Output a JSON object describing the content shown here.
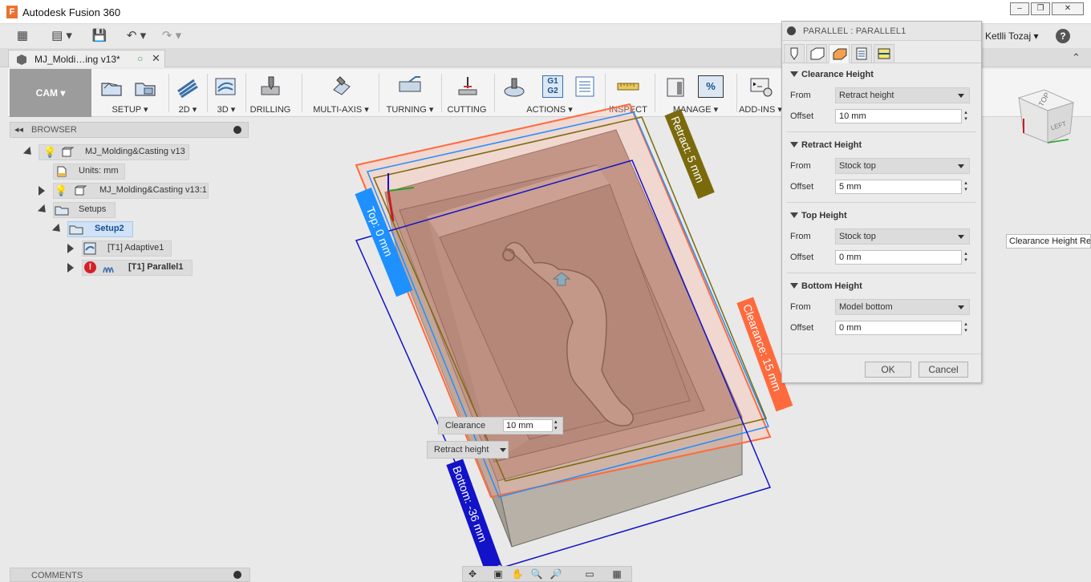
{
  "window": {
    "title": "Autodesk Fusion 360",
    "logo_letter": "F",
    "min": "–",
    "restore": "❐",
    "close": "✕"
  },
  "quick_access": {
    "grid": "▦",
    "file": "▤ ▾",
    "save": "💾",
    "undo": "↶ ▾",
    "redo": "↷ ▾"
  },
  "document": {
    "tab_label": "MJ_Moldi…ing v13*"
  },
  "user": {
    "name": "Ketlli Tozaj",
    "help": "?"
  },
  "toolbar": {
    "workspace": "CAM",
    "groups": [
      {
        "label": "SETUP"
      },
      {
        "label": "2D"
      },
      {
        "label": "3D"
      },
      {
        "label": "DRILLING"
      },
      {
        "label": "MULTI-AXIS"
      },
      {
        "label": "TURNING"
      },
      {
        "label": "CUTTING"
      },
      {
        "label": "ACTIONS"
      },
      {
        "label": "INSPECT"
      },
      {
        "label": "MANAGE"
      },
      {
        "label": "ADD-INS"
      }
    ],
    "g_code": "G1\nG2",
    "percent": "%"
  },
  "browser": {
    "title": "BROWSER",
    "items": [
      {
        "label": "MJ_Molding&Casting v13"
      },
      {
        "label": "Units: mm"
      },
      {
        "label": "MJ_Molding&Casting v13:1"
      },
      {
        "label": "Setups"
      },
      {
        "label": "Setup2"
      },
      {
        "label": "[T1] Adaptive1"
      },
      {
        "label": "[T1] Parallel1"
      }
    ]
  },
  "comments": {
    "title": "COMMENTS"
  },
  "viewport": {
    "labels": {
      "retract": "Retract: 5 mm",
      "top": "Top: 0 mm",
      "clearance": "Clearance: 15 mm",
      "bottom": "Bottom: -36 mm"
    },
    "colors": {
      "retract": "#7a6a0c",
      "top": "#1e90ff",
      "clearance": "#ff6a3d",
      "bottom": "#1212c8"
    },
    "clearance_field": {
      "label": "Clearance",
      "value": "10 mm"
    },
    "retract_dropdown": {
      "label": "Retract height"
    },
    "viewcube": {
      "top": "TOP",
      "left": "LEFT"
    },
    "tooltip": "Clearance Height Ref"
  },
  "dialog": {
    "title": "PARALLEL : PARALLEL1",
    "sections": [
      {
        "title": "Clearance Height",
        "from_label": "From",
        "from_value": "Retract height",
        "offset_label": "Offset",
        "offset_value": "10 mm"
      },
      {
        "title": "Retract Height",
        "from_label": "From",
        "from_value": "Stock top",
        "offset_label": "Offset",
        "offset_value": "5 mm"
      },
      {
        "title": "Top Height",
        "from_label": "From",
        "from_value": "Stock top",
        "offset_label": "Offset",
        "offset_value": "0 mm"
      },
      {
        "title": "Bottom Height",
        "from_label": "From",
        "from_value": "Model bottom",
        "offset_label": "Offset",
        "offset_value": "0 mm"
      }
    ],
    "ok": "OK",
    "cancel": "Cancel"
  }
}
